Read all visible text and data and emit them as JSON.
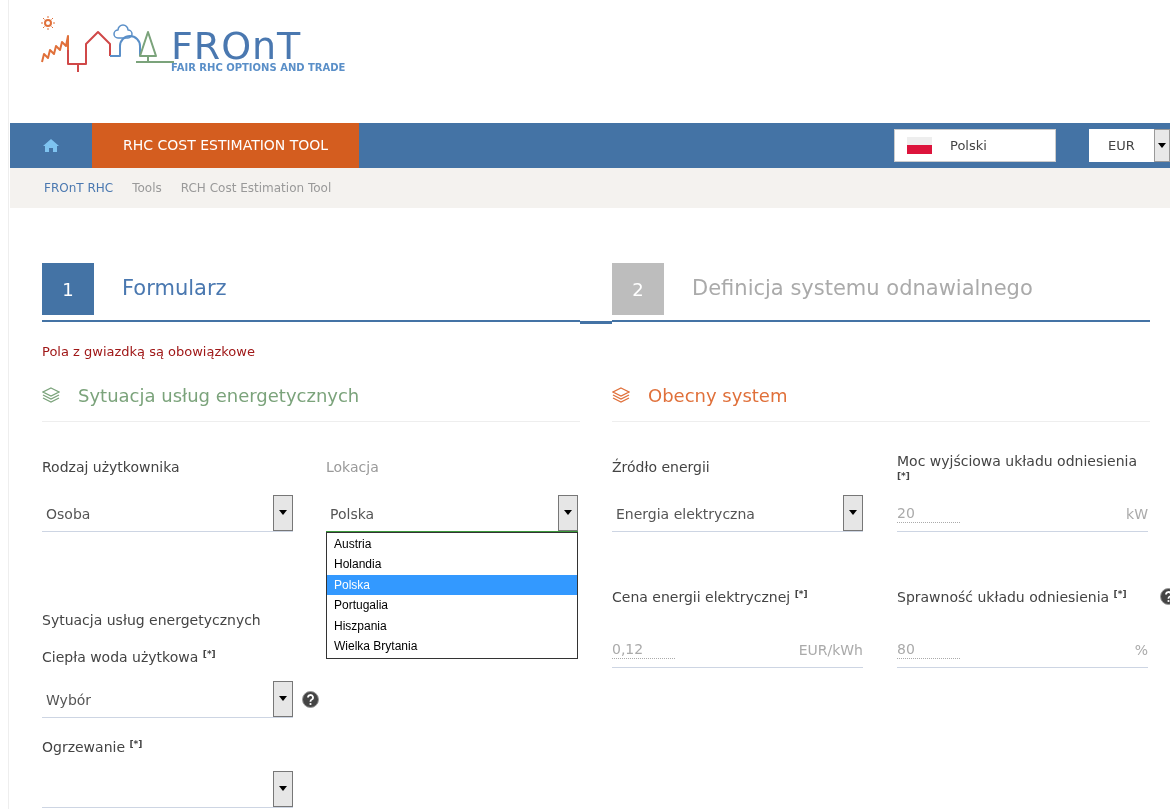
{
  "logo": {
    "title": "FROnT",
    "subtitle": "FAIR RHC OPTIONS AND TRADE"
  },
  "nav": {
    "tool_tab": "RHC COST ESTIMATION TOOL",
    "language": "Polski",
    "currency": "EUR"
  },
  "breadcrumb": [
    {
      "label": "FROnT RHC",
      "kind": "link"
    },
    {
      "label": "Tools",
      "kind": "text"
    },
    {
      "label": "RCH Cost Estimation Tool",
      "kind": "text"
    }
  ],
  "steps": [
    {
      "number": "1",
      "title": "Formularz",
      "selected": true
    },
    {
      "number": "2",
      "title": "Definicja systemu odnawialnego",
      "selected": false
    }
  ],
  "required_note": "Pola z gwiazdką są obowiązkowe",
  "sections": [
    {
      "title": "Sytuacja usług energetycznych",
      "color": "#7ba37b"
    },
    {
      "title": "Obecny system",
      "color": "#e0703a"
    }
  ],
  "left": {
    "user_type": {
      "label": "Rodzaj użytkownika",
      "value": "Osoba"
    },
    "location": {
      "label": "Lokacja",
      "value": "Polska",
      "open": true,
      "options": [
        {
          "label": "Austria",
          "selected": false
        },
        {
          "label": "Holandia",
          "selected": false
        },
        {
          "label": "Polska",
          "selected": true
        },
        {
          "label": "Portugalia",
          "selected": false
        },
        {
          "label": "Hiszpania",
          "selected": false
        },
        {
          "label": "Wielka Brytania",
          "selected": false
        }
      ]
    },
    "subheading": "Sytuacja usług energetycznych",
    "hot_water": {
      "label": "Ciepła woda użytkowa $^{[*]}$",
      "value": "Wybór"
    },
    "heating": {
      "label": "Ogrzewanie $^{[*]}$"
    }
  },
  "right": {
    "energy_source": {
      "label": "Źródło energii",
      "value": "Energia elektryczna"
    },
    "reference_power": {
      "label": "Moc wyjściowa układu odniesienia $^{[*]}$",
      "placeholder": "20",
      "unit": "kW"
    },
    "energy_price": {
      "label": "Cena energii elektrycznej $^{[*]}$",
      "placeholder": "0,12",
      "unit": "EUR/kWh"
    },
    "efficiency": {
      "label": "Sprawność układu odniesienia $^{[*]}$",
      "placeholder": "80",
      "unit": "%"
    }
  }
}
